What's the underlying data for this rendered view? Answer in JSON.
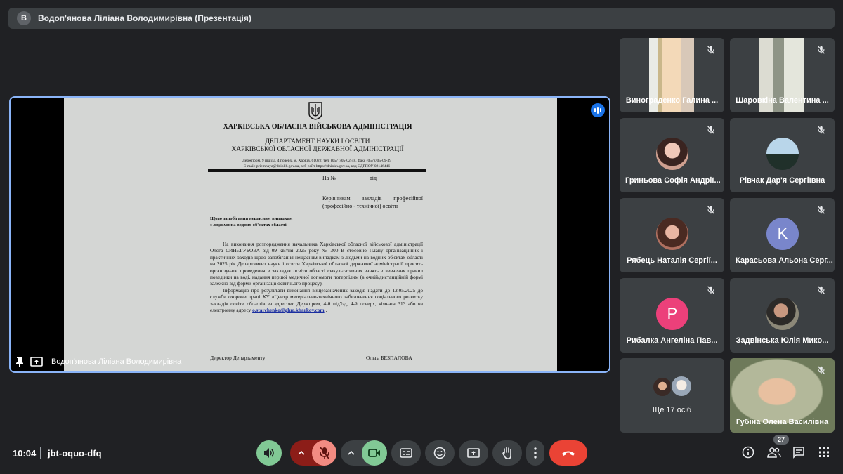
{
  "topbar": {
    "avatar_letter": "В",
    "title": "Водоп'янова Ліліана Володимирівна (Презентація)"
  },
  "stage": {
    "presenter": "Водоп'янова Ліліана Володимирівна",
    "document": {
      "org1": "ХАРКІВСЬКА ОБЛАСНА ВІЙСЬКОВА АДМІНІСТРАЦІЯ",
      "org2": "ДЕПАРТАМЕНТ НАУКИ І ОСВІТИ",
      "org3": "ХАРКІВСЬКОЇ ОБЛАСНОЇ ДЕРЖАВНОЇ АДМІНІСТРАЦІЇ",
      "address1": "Держпром, 9 під'їзд, 4 поверх, м. Харків, 61022, тел. (057)705-02-48, факс (057)705-09-39",
      "address2": "E-mail: priemnaya@dniokh.gov.ua, веб-сайт https://dniokh.gov.ua, код ЄДРПОУ 02146446",
      "number_line": "На № ___________ від ___________",
      "recipient": "Керівникам закладів професійної (професійно - технічної) освіти",
      "subject1": "Щодо запобігання нещасним випадкам",
      "subject2": "з людьми на водних об'єктах області",
      "para1": "На виконання розпорядження начальника Харківської обласної військової адміністрації Олега СИНЄГУБОВА від 09 квітня 2025 року № 300 В стосовно Плану організаційних і практичних заходів щодо запобігання нещасним випадкам з людьми на водних об'єктах області на 2025 рік Департамент науки і освіти Харківської обласної державної адміністрації просить організувати проведення в закладах освіти області факультативних занять з вивчення правил поведінки на воді, надання першої медичної допомоги потерпілим (в очній/дистанційній формі залежно від форми організації освітнього процесу).",
      "para2": "Інформацію про результати виконання вищезазначених заходів надати до 12.05.2025 до служби охорони праці КУ «Центр матеріально-технічного забезпечення соціального розвитку закладів освіти області» за адресою: Держпром, 4-й під'їзд, 4-й поверх, кімната 313 або на електронну адресу",
      "email": "o.starchenko@gluo.kharkov.com",
      "para2_end": ".",
      "sign_title": "Директор Департаменту",
      "sign_name": "Ольга БЕЗПАЛОВА"
    }
  },
  "participants": [
    {
      "name": "Винограденко Галина ...",
      "type": "video"
    },
    {
      "name": "Шаровкіна Валентина ...",
      "type": "video"
    },
    {
      "name": "Гриньова Софія Андрії...",
      "type": "photo"
    },
    {
      "name": "Рівчак Дар'я Сергіївна",
      "type": "photo"
    },
    {
      "name": "Рябець Наталія Сергії...",
      "type": "photo"
    },
    {
      "name": "Карасьова Альона Серг...",
      "type": "letter",
      "letter": "K",
      "color": "#7986cb"
    },
    {
      "name": "Рибалка Ангеліна Пав...",
      "type": "letter",
      "letter": "P",
      "color": "#ec407a"
    },
    {
      "name": "Задвінська Юлія Мико...",
      "type": "photo"
    },
    {
      "name": "Ще 17 осіб",
      "type": "more"
    },
    {
      "name": "Губіна Олена Василівна",
      "type": "video"
    }
  ],
  "bottombar": {
    "time": "10:04",
    "meeting_code": "jbt-oquo-dfq",
    "people_count": "27"
  },
  "colors": {
    "accent": "#8ab4f8",
    "end_call": "#ea4335",
    "mic_off": "#f28b82",
    "camera_on": "#81c995",
    "bg": "#202124"
  }
}
